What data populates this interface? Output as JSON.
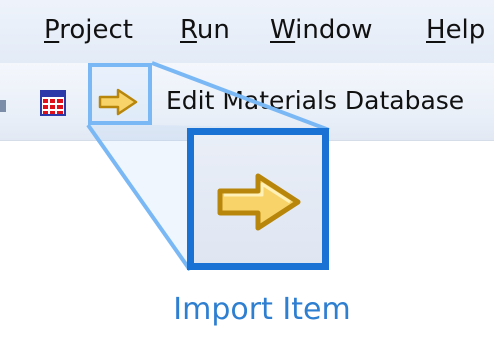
{
  "menubar": {
    "items": [
      {
        "label_ul": "P",
        "label_rest": "roject"
      },
      {
        "label_ul": "R",
        "label_rest": "un"
      },
      {
        "label_ul": "W",
        "label_rest": "indow"
      },
      {
        "label_ul": "H",
        "label_rest": "elp"
      }
    ]
  },
  "toolbar": {
    "icons": [
      "table-icon",
      "import-item-arrow-icon"
    ],
    "edit_materials_label": "Edit Materials Database"
  },
  "callout": {
    "icon": "import-item-arrow-icon",
    "caption": "Import Item",
    "highlight_color": "#1a72d4",
    "highlight_light_color": "#7ab8f5"
  },
  "colors": {
    "arrow_fill": "#f7d36a",
    "arrow_stroke": "#b8860b",
    "caption_text": "#2f7fd1"
  }
}
